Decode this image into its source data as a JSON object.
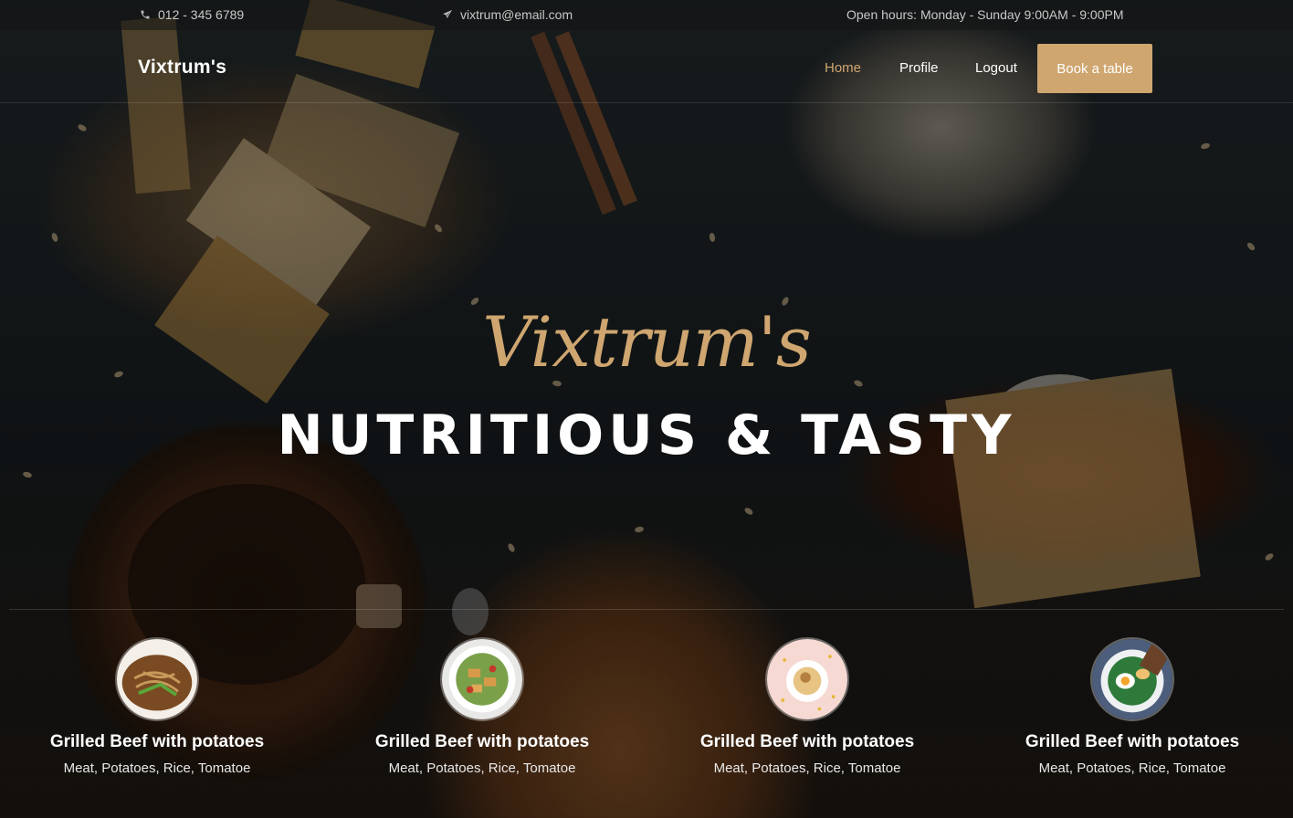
{
  "topbar": {
    "phone": "012 - 345 6789",
    "email": "vixtrum@email.com",
    "hours": "Open hours: Monday - Sunday 9:00AM - 9:00PM"
  },
  "nav": {
    "brand": "Vixtrum's",
    "links": [
      "Home",
      "Profile",
      "Logout"
    ],
    "active": "Home",
    "cta": "Book a table"
  },
  "hero": {
    "script": "Vixtrum's",
    "title": "NUTRITIOUS & TASTY"
  },
  "dishes": [
    {
      "name": "Grilled Beef with potatoes",
      "ingredients": "Meat, Potatoes, Rice, Tomatoe"
    },
    {
      "name": "Grilled Beef with potatoes",
      "ingredients": "Meat, Potatoes, Rice, Tomatoe"
    },
    {
      "name": "Grilled Beef with potatoes",
      "ingredients": "Meat, Potatoes, Rice, Tomatoe"
    },
    {
      "name": "Grilled Beef with potatoes",
      "ingredients": "Meat, Potatoes, Rice, Tomatoe"
    }
  ],
  "colors": {
    "accent": "#cfa670"
  }
}
